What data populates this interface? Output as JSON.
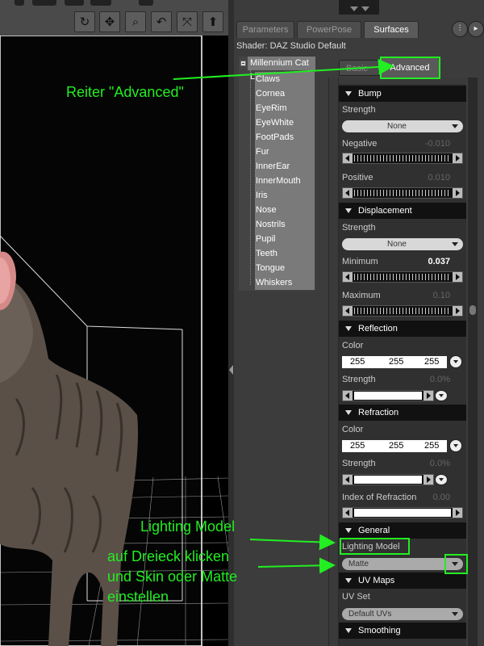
{
  "toolbar": {
    "icons": [
      "rotate-icon",
      "move-icon",
      "zoom-icon",
      "undo-arc-icon",
      "expand-icon",
      "up-arrow-icon"
    ]
  },
  "tabs": [
    {
      "label": "Parameters",
      "active": false
    },
    {
      "label": "PowerPose",
      "active": false
    },
    {
      "label": "Surfaces",
      "active": true
    }
  ],
  "shader_label": "Shader: DAZ Studio Default",
  "surface_tree": {
    "root": "Millennium Cat LE",
    "items": [
      "Claws",
      "Cornea",
      "EyeRim",
      "EyeWhite",
      "FootPads",
      "Fur",
      "InnerEar",
      "InnerMouth",
      "Iris",
      "Nose",
      "Nostrils",
      "Pupil",
      "Teeth",
      "Tongue",
      "Whiskers"
    ]
  },
  "sub_tabs": {
    "basic": "Basic",
    "advanced": "Advanced"
  },
  "sections": {
    "bump": {
      "title": "Bump",
      "strength_label": "Strength",
      "strength_value": "None",
      "negative_label": "Negative",
      "negative_value": "-0.010",
      "positive_label": "Positive",
      "positive_value": "0.010"
    },
    "displacement": {
      "title": "Displacement",
      "strength_label": "Strength",
      "strength_value": "None",
      "minimum_label": "Minimum",
      "minimum_value": "0.037",
      "maximum_label": "Maximum",
      "maximum_value": "0.10"
    },
    "reflection": {
      "title": "Reflection",
      "color_label": "Color",
      "color": [
        "255",
        "255",
        "255"
      ],
      "strength_label": "Strength",
      "strength_value": "0.0%"
    },
    "refraction": {
      "title": "Refraction",
      "color_label": "Color",
      "color": [
        "255",
        "255",
        "255"
      ],
      "strength_label": "Strength",
      "strength_value": "0.0%",
      "ior_label": "Index of Refraction",
      "ior_value": "0.00"
    },
    "general": {
      "title": "General",
      "lighting_label": "Lighting Model",
      "lighting_value": "Matte"
    },
    "uvmaps": {
      "title": "UV Maps",
      "uvset_label": "UV Set",
      "uvset_value": "Default UVs"
    },
    "smoothing": {
      "title": "Smoothing"
    }
  },
  "annotations": {
    "advanced_tab": "Reiter \"Advanced\"",
    "lighting_model": "Lighting Model",
    "instruction": [
      "auf Dreieck klicken",
      "und Skin oder Matte",
      "einstellen"
    ]
  },
  "colors": {
    "annotation": "#22ee22",
    "panel_bg": "#3c3c3c",
    "section_header": "#111111"
  }
}
